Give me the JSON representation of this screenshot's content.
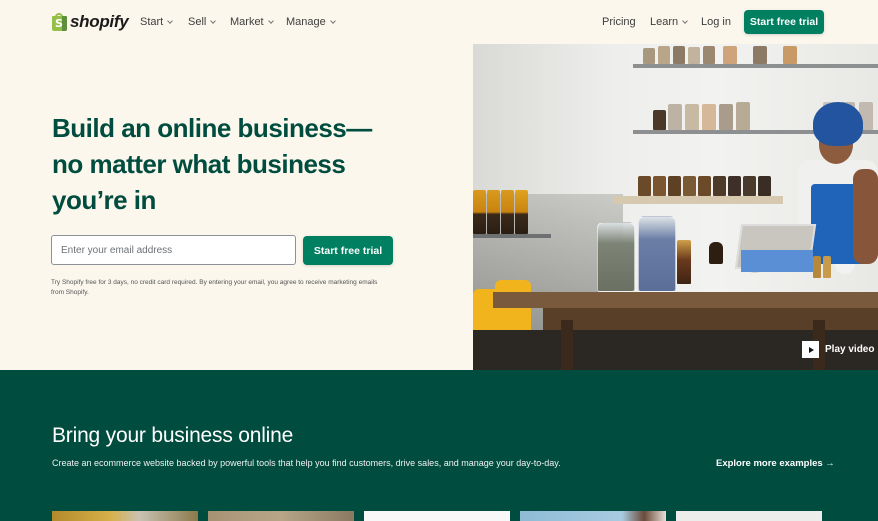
{
  "header": {
    "logo_text": "shopify",
    "logo_glyph": "S",
    "nav_left": [
      {
        "label": "Start",
        "has_dropdown": true
      },
      {
        "label": "Sell",
        "has_dropdown": true
      },
      {
        "label": "Market",
        "has_dropdown": true
      },
      {
        "label": "Manage",
        "has_dropdown": true
      }
    ],
    "nav_right": [
      {
        "label": "Pricing",
        "has_dropdown": false
      },
      {
        "label": "Learn",
        "has_dropdown": true
      },
      {
        "label": "Log in",
        "has_dropdown": false
      }
    ],
    "cta_label": "Start free trial"
  },
  "hero": {
    "title": "Build an online business—no matter what business you’re in",
    "email_placeholder": "Enter your email address",
    "email_value": "",
    "cta_label": "Start free trial",
    "fineprint": "Try Shopify free for 3 days, no credit card required. By entering your email, you agree to receive marketing emails from Shopify.",
    "image_alt": "Woman working on a tablet at a wooden table surrounded by jars of herbs",
    "play_video_label": "Play video",
    "play_icon": "play-icon"
  },
  "examples": {
    "title": "Bring your business online",
    "subtitle": "Create an ecommerce website backed by powerful tools that help you find customers, drive sales, and manage your day-to-day.",
    "explore_label": "Explore more examples →",
    "thumbnails": [
      {
        "name": "example-store-1"
      },
      {
        "name": "example-store-2"
      },
      {
        "name": "example-store-3"
      },
      {
        "name": "example-store-4"
      },
      {
        "name": "example-store-5"
      }
    ]
  },
  "colors": {
    "brand_green": "#008060",
    "dark_green": "#004c3f",
    "cream_background": "#fbf7ed",
    "logo_green": "#95bf47"
  }
}
